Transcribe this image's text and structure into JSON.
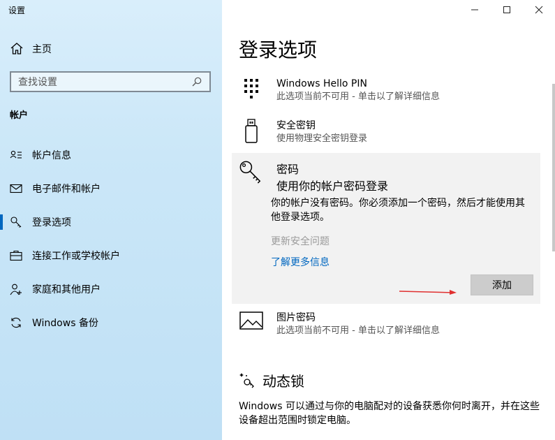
{
  "window": {
    "title": "设置"
  },
  "sidebar": {
    "home_label": "主页",
    "search_placeholder": "查找设置",
    "section_title": "帐户",
    "items": [
      {
        "label": "帐户信息",
        "icon": "account-info-icon"
      },
      {
        "label": "电子邮件和帐户",
        "icon": "mail-icon"
      },
      {
        "label": "登录选项",
        "icon": "key-icon",
        "active": true
      },
      {
        "label": "连接工作或学校帐户",
        "icon": "briefcase-icon"
      },
      {
        "label": "家庭和其他用户",
        "icon": "person-add-icon"
      },
      {
        "label": "Windows 备份",
        "icon": "sync-icon"
      }
    ]
  },
  "main": {
    "title": "登录选项",
    "options": [
      {
        "name": "Windows Hello PIN",
        "desc": "此选项当前不可用 - 单击以了解详细信息",
        "icon": "pin-keypad-icon"
      },
      {
        "name": "安全密钥",
        "desc": "使用物理安全密钥登录",
        "icon": "usb-key-icon"
      }
    ],
    "password": {
      "name": "密码",
      "desc": "使用你的帐户密码登录",
      "icon": "password-key-icon",
      "message": "你的帐户没有密码。你必须添加一个密码，然后才能使用其他登录选项。",
      "update_security_questions": "更新安全问题",
      "learn_more": "了解更多信息",
      "add_button": "添加"
    },
    "picture_password": {
      "name": "图片密码",
      "desc": "此选项当前不可用 - 单击以了解详细信息",
      "icon": "picture-icon"
    },
    "dynamic_lock": {
      "title": "动态锁",
      "icon": "dynamic-lock-icon",
      "desc": "Windows 可以通过与你的电脑配对的设备获悉你何时离开，并在这些设备超出范围时锁定电脑。"
    }
  },
  "colors": {
    "accent": "#0067c0",
    "arrow": "#e03030"
  }
}
